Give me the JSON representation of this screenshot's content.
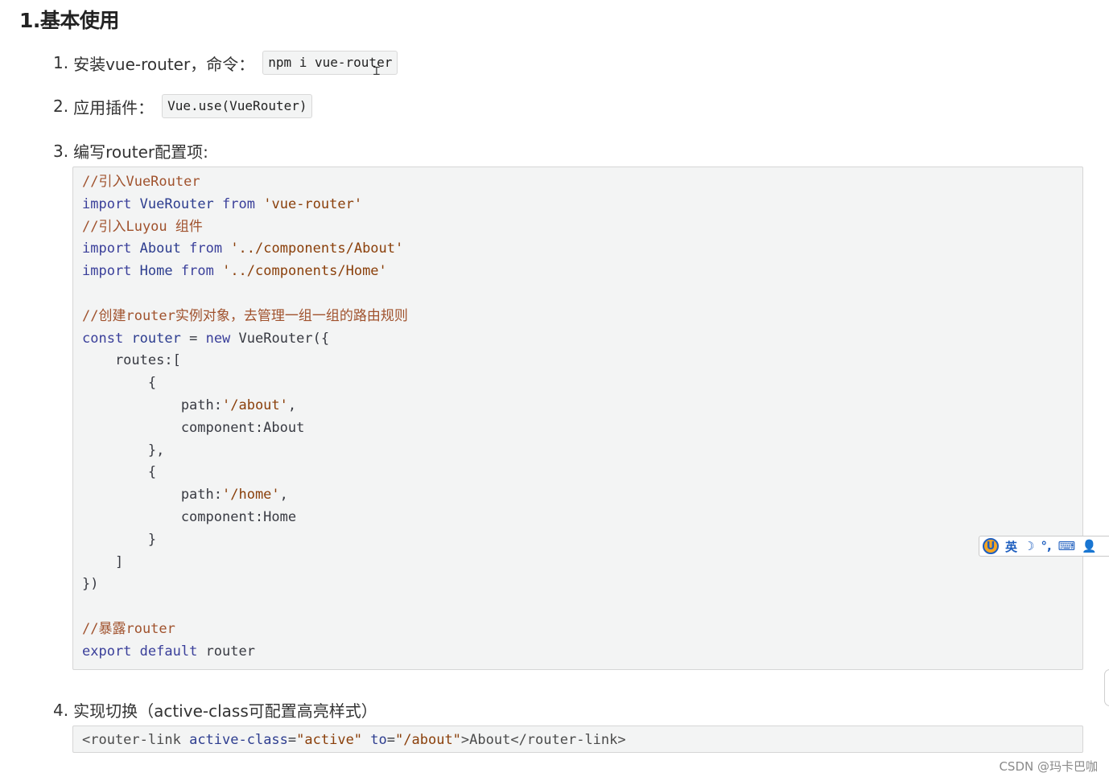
{
  "heading": "1.基本使用",
  "steps": [
    {
      "num": "1.",
      "text": "安装vue-router，命令：",
      "code": "npm i vue-router"
    },
    {
      "num": "2.",
      "text": "应用插件：",
      "code": "Vue.use(VueRouter)"
    },
    {
      "num": "3.",
      "text": "编写router配置项:"
    },
    {
      "num": "4.",
      "text": "实现切换（active-class可配置高亮样式）"
    }
  ],
  "code_block": {
    "l1": "//引入VueRouter",
    "l2_kw": "import",
    "l2_id": "VueRouter",
    "l2_from": "from",
    "l2_str": "'vue-router'",
    "l3": "//引入Luyou 组件",
    "l4_kw": "import",
    "l4_id": "About",
    "l4_from": "from",
    "l4_str": "'../components/About'",
    "l5_kw": "import",
    "l5_id": "Home",
    "l5_from": "from",
    "l5_str": "'../components/Home'",
    "l7": "//创建router实例对象，去管理一组一组的路由规则",
    "l8_kw": "const",
    "l8_id": "router",
    "l8_eq": " = ",
    "l8_new": "new",
    "l8_rest": " VueRouter({",
    "l9": "    routes:[",
    "l10": "        {",
    "l11_key": "            path:",
    "l11_str": "'/about'",
    "l11_end": ",",
    "l12": "            component:About",
    "l13": "        },",
    "l14": "        {",
    "l15_key": "            path:",
    "l15_str": "'/home'",
    "l15_end": ",",
    "l16": "            component:Home",
    "l17": "        }",
    "l18": "    ]",
    "l19": "})",
    "l21": "//暴露router",
    "l22_kw": "export",
    "l22_kw2": "default",
    "l22_rest": " router"
  },
  "code_block2": {
    "open": "<router-link",
    "attr1": "active-class",
    "eq1": "=",
    "val1": "\"active\"",
    "attr2": "to",
    "eq2": "=",
    "val2": "\"/about\"",
    "text": ">About</router-link>"
  },
  "ime": {
    "logo": "U",
    "lang": "英",
    "items": [
      "☽",
      "°,",
      "⌨",
      "👤",
      "🔧"
    ]
  },
  "watermark": "CSDN @玛卡巴咖"
}
